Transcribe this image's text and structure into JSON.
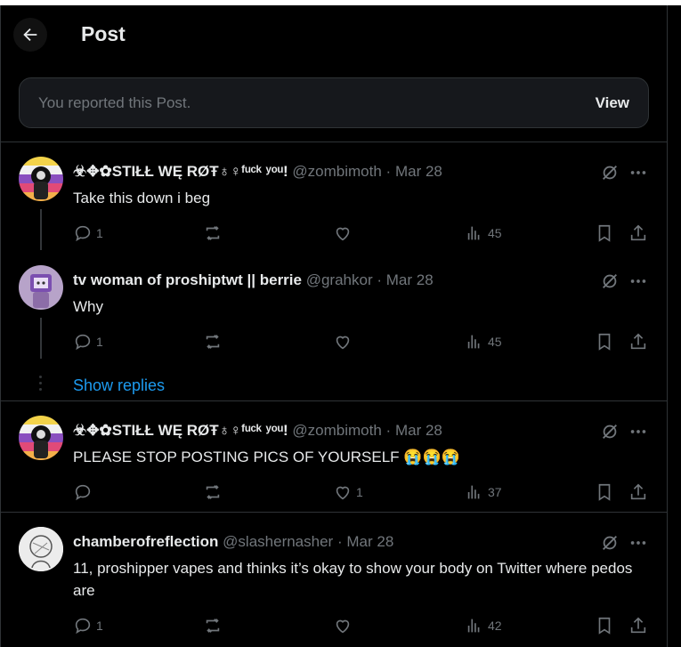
{
  "header": {
    "title": "Post"
  },
  "notice": {
    "text": "You reported this Post.",
    "action": "View"
  },
  "posts": [
    {
      "name": "☣✥✿STIŁŁ WĘ RØŦ♁♀ᶠᵘᶜᵏ ʸᵒᵘ!",
      "handle": "@zombimoth",
      "sep": "·",
      "date": "Mar 28",
      "text": "Take this down i beg",
      "stats": {
        "replies": "1",
        "reposts": "",
        "likes": "",
        "views": "45"
      }
    },
    {
      "name": "tv woman of proshiptwt || berrie",
      "handle": "@grahkor",
      "sep": "·",
      "date": "Mar 28",
      "text": "Why",
      "stats": {
        "replies": "1",
        "reposts": "",
        "likes": "",
        "views": "45"
      }
    },
    {
      "name": "☣✥✿STIŁŁ WĘ RØŦ♁♀ᶠᵘᶜᵏ ʸᵒᵘ!",
      "handle": "@zombimoth",
      "sep": "·",
      "date": "Mar 28",
      "text": "PLEASE STOP POSTING PICS OF YOURSELF 😭😭😭",
      "stats": {
        "replies": "",
        "reposts": "",
        "likes": "1",
        "views": "37"
      }
    },
    {
      "name": "chamberofreflection",
      "handle": "@slashernasher",
      "sep": "·",
      "date": "Mar 28",
      "text": "11, proshipper vapes and thinks it’s okay to show your body on Twitter where pedos are",
      "stats": {
        "replies": "1",
        "reposts": "",
        "likes": "",
        "views": "42"
      }
    }
  ],
  "thread": {
    "show_replies": "Show replies"
  },
  "icons": {
    "back": "arrow-left-icon",
    "grok": "grok-icon",
    "more": "more-icon",
    "reply": "reply-icon",
    "repost": "repost-icon",
    "like": "heart-icon",
    "views": "views-icon",
    "bookmark": "bookmark-icon",
    "share": "share-icon"
  },
  "colors": {
    "background": "#000000",
    "text": "#e7e9ea",
    "muted": "#71767b",
    "link": "#1d9bf0",
    "border": "#2f3336"
  }
}
